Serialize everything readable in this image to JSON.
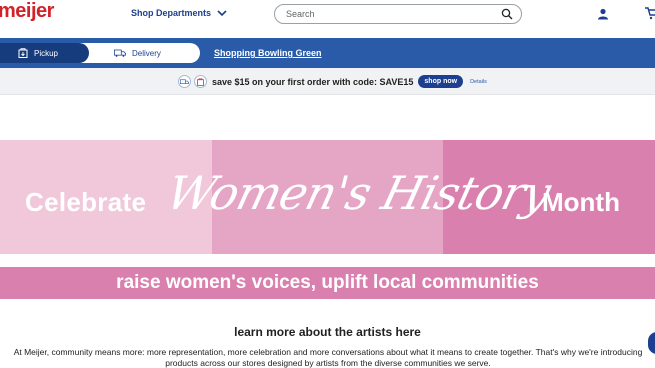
{
  "header": {
    "logo": "meijer",
    "shop_departments": "Shop Departments",
    "search_placeholder": "Search"
  },
  "fulfillment": {
    "pickup_label": "Pickup",
    "delivery_label": "Delivery",
    "store_link": "Shopping Bowling Green"
  },
  "promo": {
    "text": "save $15 on your first order with code: SAVE15",
    "button": "shop now",
    "details": "Details"
  },
  "banner": {
    "left": "Celebrate",
    "script": "Women's History",
    "right": "Month",
    "colors": [
      "#f1c8d9",
      "#e5a6c6",
      "#da80af"
    ]
  },
  "subbanner": "raise women's voices, uplift local communities",
  "content": {
    "heading": "learn more about the artists here",
    "paragraph": "At Meijer, community means more: more representation, more celebration and more conversations about what it means to create together. That's why we're introducing products across our stores designed by artists from the diverse communities we serve."
  },
  "colors": {
    "brand_red": "#d2232a",
    "brand_blue": "#2a5ba8",
    "dark_blue": "#173c7e"
  }
}
